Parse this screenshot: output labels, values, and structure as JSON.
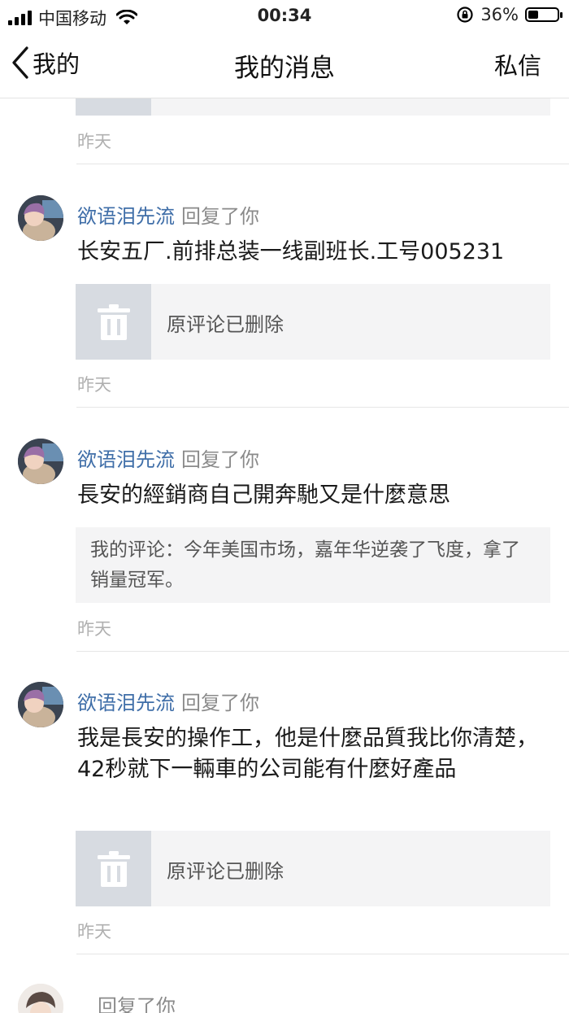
{
  "status_bar": {
    "carrier": "中国移动",
    "time": "00:34",
    "battery_text": "36%",
    "battery_level": 0.36
  },
  "nav": {
    "back_label": "我的",
    "title": "我的消息",
    "right_label": "私信"
  },
  "messages": [
    {
      "time": "昨天"
    },
    {
      "user": "欲语泪先流",
      "action": "回复了你",
      "text": "长安五厂.前排总装一线副班长.工号005231",
      "quote_deleted": "原评论已删除",
      "time": "昨天"
    },
    {
      "user": "欲语泪先流",
      "action": "回复了你",
      "text": "長安的經銷商自己開奔馳又是什麼意思",
      "quote": "我的评论：今年美国市场，嘉年华逆袭了飞度，拿了销量冠军。",
      "time": "昨天"
    },
    {
      "user": "欲语泪先流",
      "action": "回复了你",
      "text": "我是長安的操作工，他是什麼品質我比你清楚，42秒就下一輛車的公司能有什麼好產品",
      "quote_deleted": "原评论已删除",
      "time": "昨天"
    },
    {
      "action": "回复了你"
    }
  ],
  "colors": {
    "username": "#3f6ea8",
    "time": "#b0b0b0",
    "card_bg": "#f4f4f5",
    "icon_bg": "#d7dbe1"
  }
}
